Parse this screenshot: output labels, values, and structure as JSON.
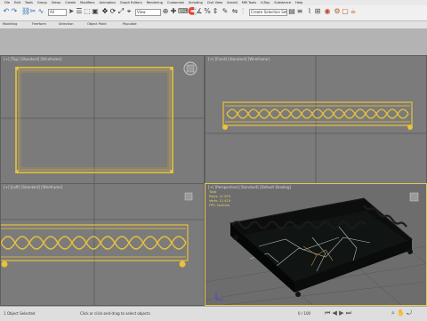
{
  "menu": [
    "File",
    "Edit",
    "Tools",
    "Group",
    "Views",
    "Create",
    "Modifiers",
    "Animation",
    "Graph Editors",
    "Rendering",
    "Customize",
    "Scripting",
    "Civil View",
    "Arnold",
    "MM Tools",
    "V-Ray",
    "Substance",
    "Help"
  ],
  "toolbar": {
    "selection_filter": "All",
    "view_dropdown": "View",
    "selection_set": "Create Selection Set"
  },
  "ribbon": {
    "items": [
      "Modeling",
      "Freeform",
      "Selection",
      "Object Paint",
      "Populate"
    ]
  },
  "viewports": {
    "top": "[+] [Top] [Standard] [Wireframe]",
    "front": "[+] [Front] [Standard] [Wireframe]",
    "left": "[+] [Left] [Standard] [Wireframe]",
    "perspective": "[+] [Perspective] [Standard] [Default Shading]"
  },
  "stats": {
    "label": "Total",
    "polys_label": "Polys:",
    "polys": "21 873",
    "verts_label": "Verts:",
    "verts": "11 419",
    "fps_label": "FPS:",
    "fps": "Inactive"
  },
  "status": {
    "frame": "0 / 100",
    "selected": "1 Object Selected",
    "prompt": "Click or click-and-drag to select objects"
  },
  "colors": {
    "wire": "#e8c23a",
    "viewport_bg": "#7b7b7b",
    "active_border": "#e8c84a"
  }
}
